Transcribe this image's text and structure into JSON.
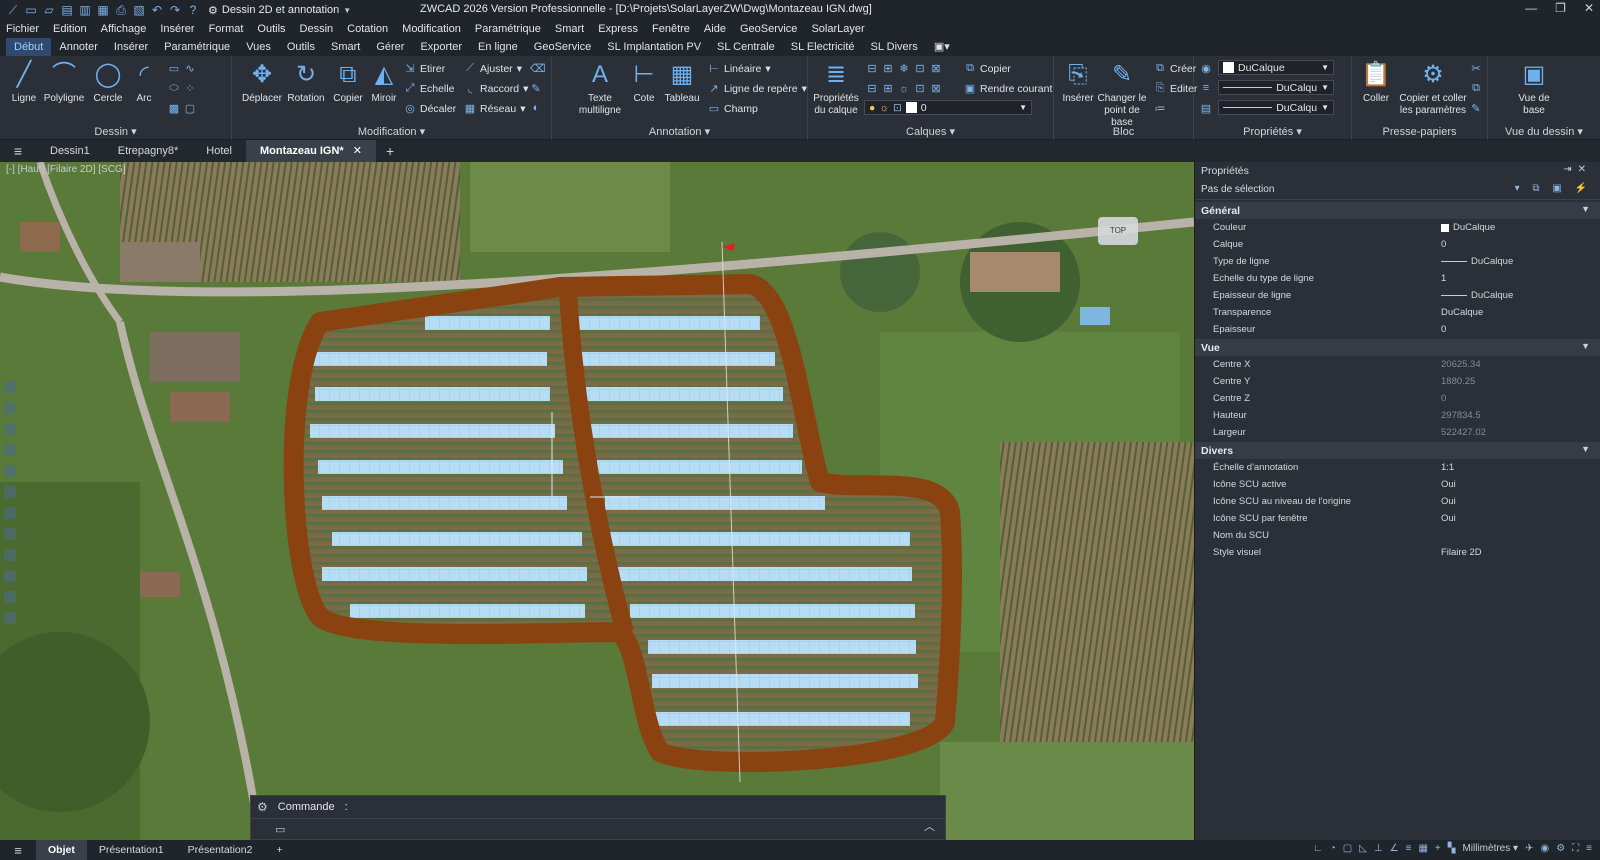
{
  "title_bar": {
    "workspace": "Dessin 2D et annotation",
    "app_title": "ZWCAD 2026 Version Professionnelle - [D:\\Projets\\SolarLayerZW\\Dwg\\Montazeau IGN.dwg]"
  },
  "menu": [
    "Fichier",
    "Edition",
    "Affichage",
    "Insérer",
    "Format",
    "Outils",
    "Dessin",
    "Cotation",
    "Modification",
    "Paramétrique",
    "Smart",
    "Express",
    "Fenêtre",
    "Aide",
    "GeoService",
    "SolarLayer"
  ],
  "ribbon_tabs": [
    "Début",
    "Annoter",
    "Insérer",
    "Paramétrique",
    "Vues",
    "Outils",
    "Smart",
    "Gérer",
    "Exporter",
    "En ligne",
    "GeoService",
    "SL Implantation PV",
    "SL Centrale",
    "SL Electricité",
    "SL Divers"
  ],
  "ribbon": {
    "dessin": {
      "title": "Dessin",
      "ligne": "Ligne",
      "polyligne": "Polyligne",
      "cercle": "Cercle",
      "arc": "Arc"
    },
    "modification": {
      "title": "Modification",
      "deplacer": "Déplacer",
      "rotation": "Rotation",
      "copier": "Copier",
      "miroir": "Miroir",
      "etirer": "Etirer",
      "echelle": "Echelle",
      "decaler": "Décaler",
      "ajuster": "Ajuster",
      "raccord": "Raccord",
      "reseau": "Réseau"
    },
    "annotation": {
      "title": "Annotation",
      "texte": "Texte multiligne",
      "cote": "Cote",
      "tableau": "Tableau",
      "lineaire": "Linéaire",
      "ligne_repere": "Ligne de repère",
      "champ": "Champ"
    },
    "calques": {
      "title": "Calques",
      "proprietes": "Propriétés du calque",
      "copier": "Copier",
      "rendre_courant": "Rendre courant",
      "current_layer": "0"
    },
    "bloc": {
      "title": "Bloc",
      "inserer": "Insérer",
      "changer": "Changer le point de base",
      "creer": "Créer",
      "editer": "Editer"
    },
    "proprietes": {
      "title": "Propriétés",
      "couleur": "DuCalque",
      "type_ligne": "DuCalqu",
      "epaisseur": "DuCalqu"
    },
    "presse_papiers": {
      "title": "Presse-papiers",
      "coller": "Coller",
      "copier_coller": "Copier et coller les paramètres"
    },
    "vue_dessin": {
      "title": "Vue du dessin",
      "vue_base": "Vue de base"
    }
  },
  "doc_tabs": [
    "Dessin1",
    "Etrepagny8*",
    "Hotel",
    "Montazeau IGN*"
  ],
  "viewport": {
    "label": "[-] [Haut] [Filaire 2D] [SCG]",
    "viewcube": "TOP"
  },
  "command": {
    "label": "Commande",
    "prompt": ":"
  },
  "properties": {
    "title": "Propriétés",
    "selection": "Pas de sélection",
    "general": {
      "title": "Général",
      "rows": [
        {
          "k": "Couleur",
          "v": "DuCalque"
        },
        {
          "k": "Calque",
          "v": "0"
        },
        {
          "k": "Type de ligne",
          "v": "DuCalque"
        },
        {
          "k": "Echelle du type de ligne",
          "v": "1"
        },
        {
          "k": "Epaisseur de ligne",
          "v": "DuCalque"
        },
        {
          "k": "Transparence",
          "v": "DuCalque"
        },
        {
          "k": "Epaisseur",
          "v": "0"
        }
      ]
    },
    "vue": {
      "title": "Vue",
      "rows": [
        {
          "k": "Centre X",
          "v": "20625.34"
        },
        {
          "k": "Centre Y",
          "v": "1880.25"
        },
        {
          "k": "Centre Z",
          "v": "0"
        },
        {
          "k": "Hauteur",
          "v": "297834.5"
        },
        {
          "k": "Largeur",
          "v": "522427.02"
        }
      ]
    },
    "divers": {
      "title": "Divers",
      "rows": [
        {
          "k": "Échelle d'annotation",
          "v": "1:1"
        },
        {
          "k": "Icône SCU active",
          "v": "Oui"
        },
        {
          "k": "Icône SCU au niveau de l'origine",
          "v": "Oui"
        },
        {
          "k": "Icône SCU par fenêtre",
          "v": "Oui"
        },
        {
          "k": "Nom du SCU",
          "v": ""
        },
        {
          "k": "Style visuel",
          "v": "Filaire 2D"
        }
      ]
    }
  },
  "status_tabs": [
    "Objet",
    "Présentation1",
    "Présentation2"
  ],
  "status": {
    "units": "Millimètres"
  },
  "colors": {
    "accent": "#3b82d6",
    "boundary": "#8a4310",
    "panels": "#a9d7f2"
  }
}
